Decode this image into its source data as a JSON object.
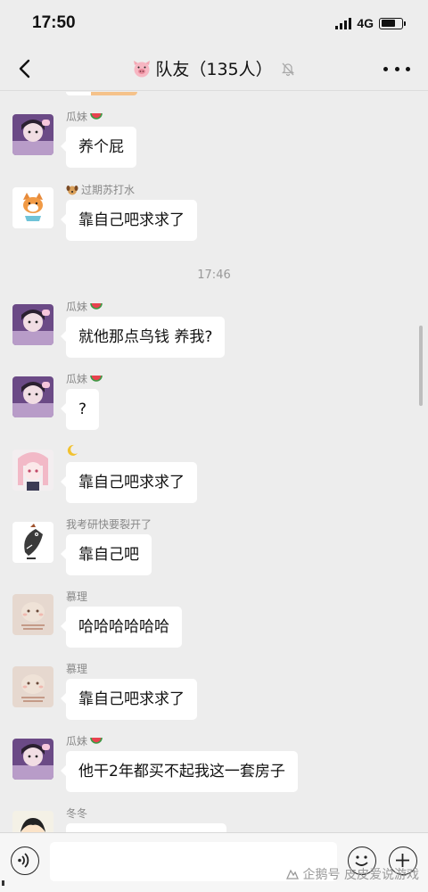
{
  "status_bar": {
    "time": "17:50",
    "network": "4G",
    "battery_level": 0.7
  },
  "header": {
    "title": "队友（135人）",
    "title_icon": "pig-emoji-icon",
    "muted_icon": "bell-muted-icon"
  },
  "chat": {
    "timestamp": "17:46",
    "messages": [
      {
        "sender": "瓜妹",
        "sender_emoji": "watermelon-icon",
        "avatar": "avatar-girl-purple",
        "text": "养个屁"
      },
      {
        "sender": "过期苏打水",
        "sender_emoji": "dog-icon",
        "avatar": "avatar-shiba-dog",
        "text": "靠自己吧求求了"
      },
      {
        "sender": "瓜妹",
        "sender_emoji": "watermelon-icon",
        "avatar": "avatar-girl-purple",
        "text": "就他那点鸟钱 养我?"
      },
      {
        "sender": "瓜妹",
        "sender_emoji": "watermelon-icon",
        "avatar": "avatar-girl-purple",
        "text": "?"
      },
      {
        "sender": "",
        "sender_emoji": "crescent-moon-icon",
        "avatar": "avatar-pink-anime",
        "text": "靠自己吧求求了"
      },
      {
        "sender": "我考研快要裂开了",
        "sender_emoji": "",
        "avatar": "avatar-fish-cartoon",
        "text": "靠自己吧"
      },
      {
        "sender": "慕理",
        "sender_emoji": "",
        "avatar": "avatar-beige-plush",
        "text": "哈哈哈哈哈哈"
      },
      {
        "sender": "慕理",
        "sender_emoji": "",
        "avatar": "avatar-beige-plush",
        "text": "靠自己吧求求了"
      },
      {
        "sender": "瓜妹",
        "sender_emoji": "watermelon-icon",
        "avatar": "avatar-girl-purple",
        "text": "他干2年都买不起我这一套房子"
      },
      {
        "sender": "冬冬",
        "sender_emoji": "",
        "avatar": "avatar-cartoon-boy",
        "text": ""
      }
    ]
  },
  "input_bar": {
    "placeholder": "",
    "voice_icon": "voice-icon",
    "emoji_icon": "emoji-icon",
    "plus_icon": "plus-icon"
  },
  "watermark": {
    "text": "企鹅号 皮皮爱说游戏"
  },
  "colors": {
    "background": "#ededed",
    "bubble": "#ffffff",
    "timestamp": "#999999",
    "sender_name": "#888888"
  }
}
